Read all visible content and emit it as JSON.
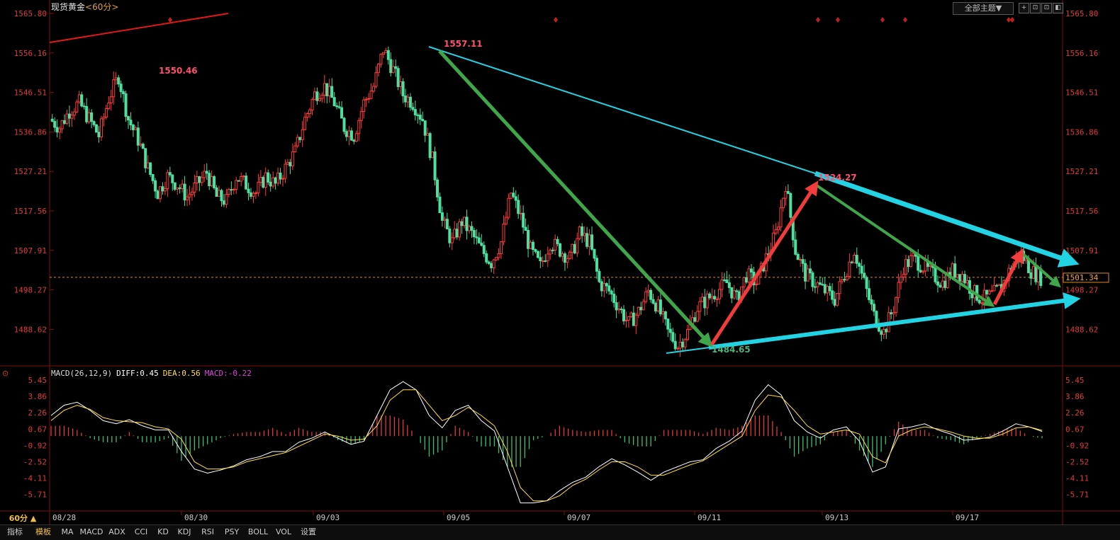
{
  "header": {
    "instrument": "现货黄金",
    "period_tag": "<60分>",
    "theme_button": "全部主题▼",
    "window_buttons": [
      "+",
      "⊡",
      "⊡",
      "◧"
    ]
  },
  "price_axis": {
    "ticks": [
      "1565.80",
      "1556.16",
      "1546.51",
      "1536.86",
      "1527.21",
      "1517.56",
      "1507.91",
      "1498.27",
      "1488.62"
    ],
    "current_price": "1501.34"
  },
  "macd": {
    "legend_name": "MACD(26,12,9)",
    "diff": "DIFF:0.45",
    "dea": "DEA:0.56",
    "macd": "MACD:-0.22",
    "ticks": [
      "5.45",
      "3.86",
      "2.26",
      "0.67",
      "-0.92",
      "-2.52",
      "-4.11",
      "-5.71"
    ]
  },
  "annotations": {
    "labels": [
      "1557.11",
      "1550.46",
      "1524.27",
      "1484.65"
    ]
  },
  "time_axis": {
    "labels": [
      "08/28",
      "08/30",
      "09/03",
      "09/05",
      "09/07",
      "09/11",
      "09/13",
      "09/17"
    ]
  },
  "bottom_bar": {
    "period": "60分 ▲",
    "tabs": [
      "指标",
      "模板",
      "MA",
      "MACD",
      "ADX",
      "CCI",
      "KD",
      "KDJ",
      "RSI",
      "PSY",
      "BOLL",
      "VOL",
      "设置"
    ]
  },
  "colors": {
    "up": "#ff3b3b",
    "down": "#4de0a0",
    "resistance_line": "#22d3e3",
    "down_arrow": "#3fa64a",
    "up_arrow": "#f23b3b",
    "diff_line": "#ffffff",
    "dea_line": "#ffe23a",
    "price_label": "#ff5070",
    "low_label": "#4db37f"
  },
  "chart_data": {
    "type": "candlestick",
    "title": "现货黄金<60分>",
    "ylim": [
      1480,
      1568
    ],
    "x_labels": [
      "08/28",
      "08/30",
      "09/03",
      "09/05",
      "09/07",
      "09/11",
      "09/13",
      "09/17"
    ],
    "current_price": 1501.34,
    "key_points": [
      {
        "label": "1550.46",
        "value": 1550.46
      },
      {
        "label": "1557.11",
        "value": 1557.11
      },
      {
        "label": "1484.65",
        "value": 1484.65
      },
      {
        "label": "1524.27",
        "value": 1524.27
      }
    ],
    "price_path": [
      1540,
      1538,
      1542,
      1544,
      1540,
      1536,
      1545,
      1550.46,
      1540,
      1535,
      1528,
      1522,
      1526,
      1524,
      1521,
      1524,
      1527,
      1521,
      1520,
      1526,
      1524,
      1522,
      1526,
      1524,
      1528,
      1532,
      1540,
      1546,
      1548,
      1544,
      1538,
      1536,
      1544,
      1548,
      1557.11,
      1552,
      1546,
      1544,
      1540,
      1530,
      1515,
      1510,
      1515,
      1512,
      1508,
      1505,
      1510,
      1522,
      1516,
      1508,
      1504,
      1510,
      1508,
      1506,
      1512,
      1510,
      1500,
      1498,
      1494,
      1490,
      1493,
      1498,
      1494,
      1488,
      1484.65,
      1488,
      1494,
      1496,
      1498,
      1500,
      1496,
      1502,
      1500,
      1506,
      1512,
      1524.27,
      1508,
      1502,
      1500,
      1498,
      1496,
      1502,
      1508,
      1500,
      1492,
      1488,
      1494,
      1504,
      1506,
      1504,
      1502,
      1500,
      1503,
      1502,
      1498,
      1496,
      1497,
      1499,
      1504,
      1507,
      1503,
      1501.34
    ],
    "macd": {
      "diff_last": 0.45,
      "dea_last": 0.56,
      "macd_last": -0.22,
      "ylim": [
        -6.5,
        5.9
      ],
      "diff_path": [
        2,
        3,
        3.3,
        2.5,
        1.5,
        1.2,
        1.6,
        1.0,
        0.6,
        0.6,
        -1.5,
        -3.2,
        -3.6,
        -3.3,
        -2.9,
        -2.3,
        -2.0,
        -1.5,
        -1.5,
        -0.6,
        -0.2,
        0.4,
        -0.2,
        -0.8,
        -0.5,
        2.0,
        4.5,
        5.3,
        4.5,
        2.0,
        0.8,
        2.5,
        3.0,
        1.5,
        0.5,
        -3.0,
        -6.5,
        -6.5,
        -6.3,
        -5.3,
        -4.5,
        -4.0,
        -3.0,
        -2.2,
        -2.8,
        -3.5,
        -4.3,
        -3.5,
        -3.0,
        -2.5,
        -2.3,
        -1.2,
        -0.5,
        0.5,
        3.5,
        5.0,
        4.0,
        1.5,
        0.4,
        -0.2,
        0.6,
        0.9,
        -0.5,
        -3.5,
        -3.0,
        0.7,
        0.9,
        1.2,
        0.6,
        0.2,
        -0.4,
        -0.3,
        -0.1,
        0.5,
        1.2,
        0.9,
        0.45
      ],
      "dea_path": [
        1.5,
        2.5,
        3.0,
        2.6,
        1.8,
        1.5,
        1.4,
        1.3,
        0.9,
        0.7,
        -0.3,
        -2.5,
        -3.2,
        -3.2,
        -3.0,
        -2.5,
        -2.2,
        -1.9,
        -1.6,
        -1.0,
        -0.4,
        0.2,
        0.0,
        -0.4,
        -0.3,
        1.0,
        3.5,
        4.5,
        4.5,
        3.0,
        1.5,
        2.0,
        2.8,
        2.0,
        1.0,
        -1.5,
        -5.0,
        -6.3,
        -6.3,
        -5.8,
        -4.8,
        -4.2,
        -3.3,
        -2.5,
        -2.5,
        -3.0,
        -3.8,
        -3.8,
        -3.3,
        -2.8,
        -2.4,
        -1.6,
        -0.8,
        0.0,
        2.5,
        4.0,
        3.8,
        2.5,
        1.0,
        0.2,
        0.4,
        0.6,
        0.2,
        -2.0,
        -2.6,
        0.0,
        0.6,
        0.9,
        0.7,
        0.4,
        0.0,
        -0.2,
        -0.2,
        0.2,
        0.8,
        0.9,
        0.56
      ]
    }
  }
}
